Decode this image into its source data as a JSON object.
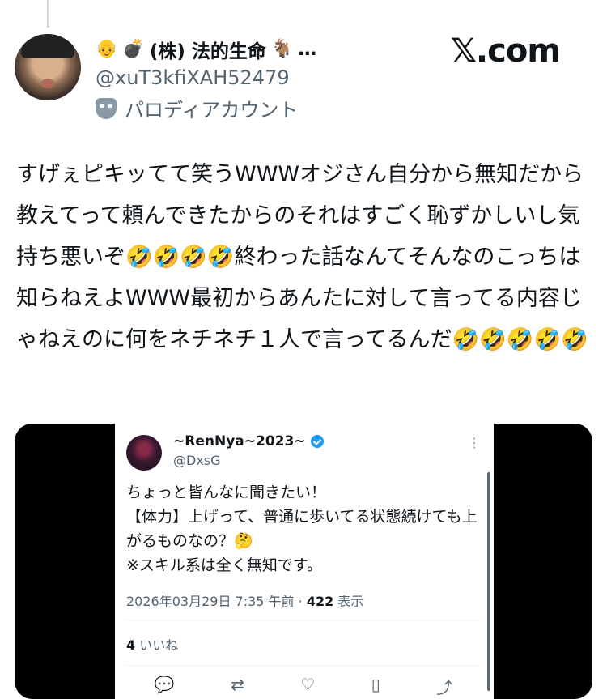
{
  "author": {
    "name_emojis": [
      "👴",
      "💣"
    ],
    "name": "(株) 法的生命",
    "name_trailing_emoji": "🐐",
    "name_ellipsis": "…",
    "handle": "@xuT3kfiXAH52479",
    "parody_label": "パロディアカウント"
  },
  "brand": "𝕏.com",
  "tweet": {
    "segments": [
      "すげぇピキッてて笑うWWWオジさん自分から無知だから教えてって頼んできたからのそれはすごく恥ずかしいし気持ち悪いぞ",
      "🤣🤣🤣🤣",
      "終わった話なんてそんなのこっちは知らねえよWWW最初からあんたに対して言ってる内容じゃねえのに何をネチネチ１人で言ってるんだ",
      "🤣🤣🤣🤣🤣"
    ]
  },
  "quoted": {
    "name": "~RenNya~2023~",
    "handle": "@DxsG",
    "lines": [
      "ちょっと皆んなに聞きたい！",
      "【体力】上げって、普通に歩いてる状態続けても上がるものなの？🤔",
      "※スキル系は全く無知です。"
    ],
    "timestamp": "2026年03月29日 7:35 午前 · ",
    "views_count": "422",
    "views_label": " 表示",
    "likes_count": "4",
    "likes_label": " いいね",
    "more_glyph": "⋮",
    "actions": [
      "reply-icon",
      "retweet-icon",
      "like-icon",
      "bookmark-icon",
      "share-icon"
    ]
  }
}
